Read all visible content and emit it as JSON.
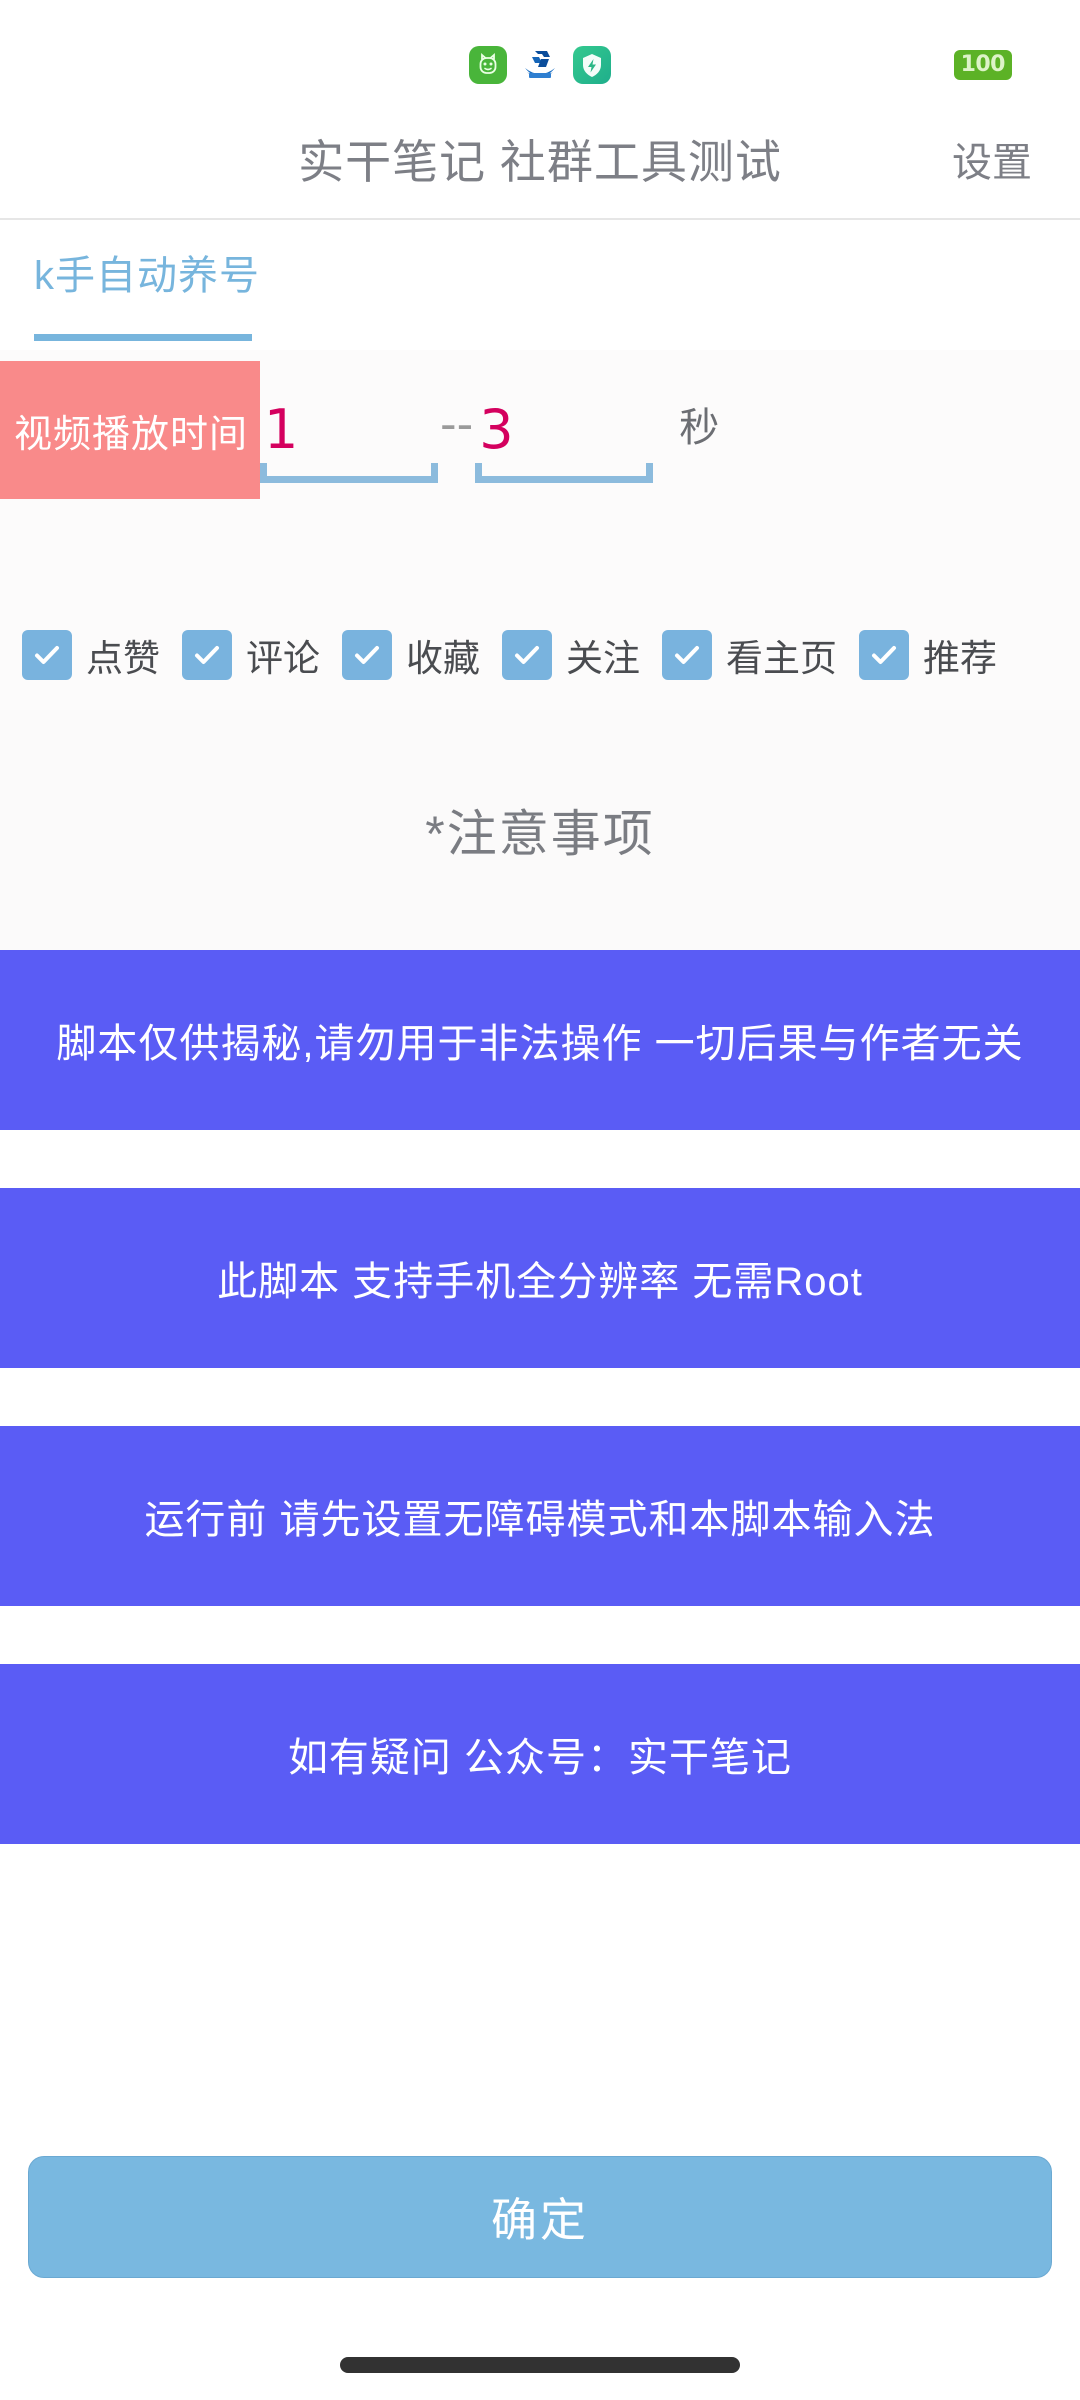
{
  "statusbar": {
    "app_icons": [
      {
        "name": "cat-face-app-icon",
        "color": "#49b53a"
      },
      {
        "name": "ccb-bank-app-icon",
        "color": "#0b4d9b"
      },
      {
        "name": "shield-bolt-app-icon",
        "color": "#2ab786"
      }
    ],
    "battery_level": "100",
    "battery_color": "#5cb226"
  },
  "titlebar": {
    "title": "实干笔记 社群工具测试",
    "settings_label": "设置"
  },
  "tabs": [
    {
      "label": "k手自动养号",
      "active": true
    }
  ],
  "settings": {
    "range_field": {
      "label": "视频播放时间",
      "label_bg": "#f98a8a",
      "min_value": "1",
      "separator": "--",
      "max_value": "3",
      "unit": "秒",
      "value_color": "#d4005e",
      "underline_color": "#8cbbdd"
    },
    "checkboxes": [
      {
        "label": "点赞",
        "checked": true
      },
      {
        "label": "评论",
        "checked": true
      },
      {
        "label": "收藏",
        "checked": true
      },
      {
        "label": "关注",
        "checked": true
      },
      {
        "label": "看主页",
        "checked": true
      },
      {
        "label": "推荐",
        "checked": true
      }
    ],
    "checkbox_color": "#79b3de"
  },
  "notes": {
    "heading": "*注意事项",
    "banner_color": "#5a5cf5",
    "items": [
      "脚本仅供揭秘,请勿用于非法操作 一切后果与作者无关",
      "此脚本 支持手机全分辨率 无需Root",
      "运行前 请先设置无障碍模式和本脚本输入法",
      "如有疑问 公众号：实干笔记"
    ]
  },
  "footer": {
    "confirm_label": "确定",
    "confirm_color": "#79b8e0"
  }
}
